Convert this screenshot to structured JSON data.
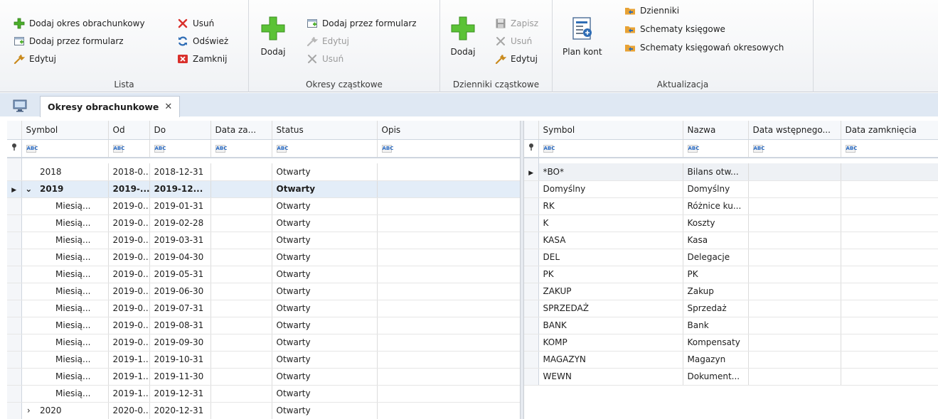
{
  "ribbon": {
    "lista": {
      "label": "Lista",
      "add_period": "Dodaj okres obrachunkowy",
      "add_form": "Dodaj przez formularz",
      "edit": "Edytuj",
      "delete": "Usuń",
      "refresh": "Odśwież",
      "close": "Zamknij"
    },
    "okresy": {
      "label": "Okresy cząstkowe",
      "add": "Dodaj",
      "add_form": "Dodaj przez formularz",
      "edit": "Edytuj",
      "delete": "Usuń"
    },
    "dzienniki": {
      "label": "Dzienniki cząstkowe",
      "add": "Dodaj",
      "save": "Zapisz",
      "delete": "Usuń",
      "edit": "Edytuj"
    },
    "aktualizacja": {
      "label": "Aktualizacja",
      "plan_kont": "Plan kont",
      "dzienniki": "Dzienniki",
      "schematy": "Schematy księgowe",
      "schematy_okresowe": "Schematy księgowań okresowych"
    }
  },
  "tabs": {
    "active": "Okresy obrachunkowe",
    "close_glyph": "✕"
  },
  "filter_glyph": "ABC",
  "left_grid": {
    "headers": [
      "Symbol",
      "Od",
      "Do",
      "Data za...",
      "Status",
      "Opis"
    ],
    "rows": [
      {
        "symbol": "2018",
        "od": "2018-0...",
        "do": "2018-12-31",
        "data_za": "",
        "status": "Otwarty",
        "opis": ""
      },
      {
        "symbol": "2019",
        "od": "2019-...",
        "do": "2019-12...",
        "data_za": "",
        "status": "Otwarty",
        "opis": ""
      },
      {
        "symbol": "Miesią...",
        "od": "2019-0...",
        "do": "2019-01-31",
        "data_za": "",
        "status": "Otwarty",
        "opis": ""
      },
      {
        "symbol": "Miesią...",
        "od": "2019-0...",
        "do": "2019-02-28",
        "data_za": "",
        "status": "Otwarty",
        "opis": ""
      },
      {
        "symbol": "Miesią...",
        "od": "2019-0...",
        "do": "2019-03-31",
        "data_za": "",
        "status": "Otwarty",
        "opis": ""
      },
      {
        "symbol": "Miesią...",
        "od": "2019-0...",
        "do": "2019-04-30",
        "data_za": "",
        "status": "Otwarty",
        "opis": ""
      },
      {
        "symbol": "Miesią...",
        "od": "2019-0...",
        "do": "2019-05-31",
        "data_za": "",
        "status": "Otwarty",
        "opis": ""
      },
      {
        "symbol": "Miesią...",
        "od": "2019-0...",
        "do": "2019-06-30",
        "data_za": "",
        "status": "Otwarty",
        "opis": ""
      },
      {
        "symbol": "Miesią...",
        "od": "2019-0...",
        "do": "2019-07-31",
        "data_za": "",
        "status": "Otwarty",
        "opis": ""
      },
      {
        "symbol": "Miesią...",
        "od": "2019-0...",
        "do": "2019-08-31",
        "data_za": "",
        "status": "Otwarty",
        "opis": ""
      },
      {
        "symbol": "Miesią...",
        "od": "2019-0...",
        "do": "2019-09-30",
        "data_za": "",
        "status": "Otwarty",
        "opis": ""
      },
      {
        "symbol": "Miesią...",
        "od": "2019-1...",
        "do": "2019-10-31",
        "data_za": "",
        "status": "Otwarty",
        "opis": ""
      },
      {
        "symbol": "Miesią...",
        "od": "2019-1...",
        "do": "2019-11-30",
        "data_za": "",
        "status": "Otwarty",
        "opis": ""
      },
      {
        "symbol": "Miesią...",
        "od": "2019-1...",
        "do": "2019-12-31",
        "data_za": "",
        "status": "Otwarty",
        "opis": ""
      },
      {
        "symbol": "2020",
        "od": "2020-0...",
        "do": "2020-12-31",
        "data_za": "",
        "status": "Otwarty",
        "opis": ""
      }
    ]
  },
  "right_grid": {
    "headers": [
      "Symbol",
      "Nazwa",
      "Data wstępnego...",
      "Data zamknięcia"
    ],
    "rows": [
      {
        "symbol": "*BO*",
        "nazwa": "Bilans otw...",
        "data_wst": "",
        "data_zam": ""
      },
      {
        "symbol": "Domyślny",
        "nazwa": "Domyślny",
        "data_wst": "",
        "data_zam": ""
      },
      {
        "symbol": "RK",
        "nazwa": "Różnice ku...",
        "data_wst": "",
        "data_zam": ""
      },
      {
        "symbol": "K",
        "nazwa": "Koszty",
        "data_wst": "",
        "data_zam": ""
      },
      {
        "symbol": "KASA",
        "nazwa": "Kasa",
        "data_wst": "",
        "data_zam": ""
      },
      {
        "symbol": "DEL",
        "nazwa": "Delegacje",
        "data_wst": "",
        "data_zam": ""
      },
      {
        "symbol": "PK",
        "nazwa": "PK",
        "data_wst": "",
        "data_zam": ""
      },
      {
        "symbol": "ZAKUP",
        "nazwa": "Zakup",
        "data_wst": "",
        "data_zam": ""
      },
      {
        "symbol": "SPRZEDAŻ",
        "nazwa": "Sprzedaż",
        "data_wst": "",
        "data_zam": ""
      },
      {
        "symbol": "BANK",
        "nazwa": "Bank",
        "data_wst": "",
        "data_zam": ""
      },
      {
        "symbol": "KOMP",
        "nazwa": "Kompensaty",
        "data_wst": "",
        "data_zam": ""
      },
      {
        "symbol": "MAGAZYN",
        "nazwa": "Magazyn",
        "data_wst": "",
        "data_zam": ""
      },
      {
        "symbol": "WEWN",
        "nazwa": "Dokument...",
        "data_wst": "",
        "data_zam": ""
      }
    ]
  },
  "colors": {
    "add_green": "#4caf2b",
    "delete_red": "#d9302b",
    "refresh_blue": "#2f6db5",
    "folder_orange": "#e8a234",
    "selected_row": "#e3edf8"
  }
}
